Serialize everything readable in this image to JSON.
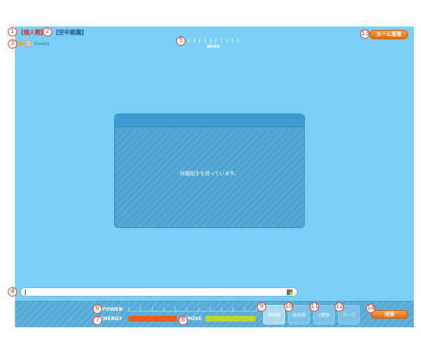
{
  "header": {
    "mode_label": "【個人戦】",
    "map_label": "【空中庭園】",
    "username": "Guest1",
    "wind_label": "WIND",
    "room_button": "ルーム管理"
  },
  "dialog": {
    "message": "対戦相手を待っています。"
  },
  "chat": {
    "value": "",
    "placeholder": ""
  },
  "controls": {
    "power_label": "POWER",
    "energy_label": "ENERGY",
    "move_label": "MOVE",
    "energy_level": 0.38,
    "move_level": 0.39,
    "shots": [
      {
        "label": "通常弾",
        "selected": true
      },
      {
        "label": "強化弾",
        "selected": false
      },
      {
        "label": "3連弾",
        "selected": false
      },
      {
        "label": "ワープ",
        "selected": false
      }
    ],
    "exit_button": "退室"
  },
  "annotations": [
    "1",
    "2",
    "3",
    "4",
    "5",
    "6",
    "7",
    "8",
    "9",
    "10",
    "11",
    "12",
    "13",
    "14"
  ],
  "colors": {
    "stage_bg": "#79cff5",
    "dialog_bg": "#54a9d6",
    "accent_orange": "#e46b0c",
    "energy": "#ee5a17",
    "move": "#c4d32b",
    "annotation_red": "#d23a2a"
  }
}
